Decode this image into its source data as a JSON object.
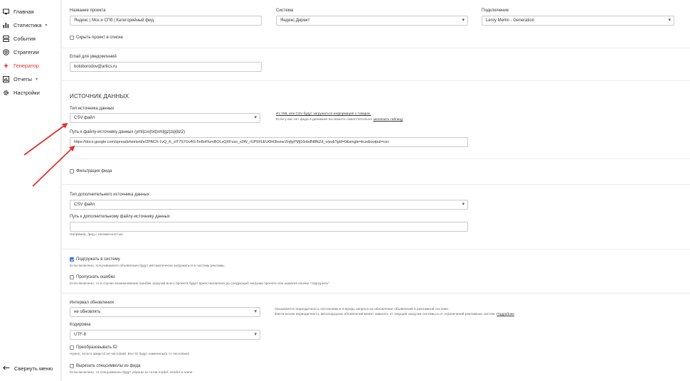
{
  "sidebar": {
    "items": [
      {
        "label": "Главная",
        "icon": "monitor-icon"
      },
      {
        "label": "Статистика",
        "icon": "bar-chart-icon"
      },
      {
        "label": "События",
        "icon": "events-icon"
      },
      {
        "label": "Стратегии",
        "icon": "target-icon"
      },
      {
        "label": "Генератор",
        "icon": "generator-icon"
      },
      {
        "label": "Отчеты",
        "icon": "reports-icon"
      },
      {
        "label": "Настройки",
        "icon": "gear-icon"
      }
    ],
    "collapse_label": "Свернуть меню"
  },
  "form": {
    "project_name_label": "Название проекта",
    "project_name_value": "Яндекс | Мск и СПб | Категорийный фид",
    "system_label": "Система",
    "system_value": "Яндекс.Директ",
    "connection_label": "Подключение",
    "connection_value": "Leroy Merlin - Generation",
    "hide_project_label": "Скрыть проект в списке",
    "email_label": "Email для уведомлений",
    "email_value": "boloborodov@artics.ru",
    "data_source_heading": "ИСТОЧНИК ДАННЫХ",
    "source_type_label": "Тип источника данных",
    "source_type_value": "CSV файл",
    "source_hint_link": "Из YML или CSV будут загружаться информация о товарах.",
    "source_hint_text": "Если у вас нет фида в динамике вы можете самостоятельно",
    "source_hint_fill": "заполнить таблицу",
    "source_path_label": "Путь к файлу-источнику данных (yml|csv|txt|xml|gz|zip|bz2)",
    "source_path_value": "https://docs.google.com/spreadsheets/d/e/2PACX-1vQ_K_sIT7S7GvAS-5n8oFlumBOLsQXFuso_s0W_rUP9XLEUOH3tozw/ZnjfgYMj16nbdN8fkZd_v/pub?gid=0&single=true&output=csv",
    "filter_label": "Фильтрация фида",
    "extra_source_type_label": "Тип дополнительного источника данных",
    "extra_source_type_value": "CSV файл",
    "extra_source_path_label": "Путь к дополнительному файлу-источнику данных",
    "extra_source_path_value": "",
    "extra_source_hint": "Например, фид с неизменностью.",
    "load_label": "Подгружать в систему",
    "load_hint": "Если включено, получившиеся объявления будут автоматически загружаться в систему рекламы.",
    "skip_errors_label": "Пропускать ошибки",
    "skip_errors_hint": "Если включено, то в случае возникновения ошибки загрузки всего проекта будет приостановлена до следующей загрузки проекта или нажатия кнопки \"подгрузить\".",
    "interval_label": "Интервал обновления",
    "interval_value": "не обновлять",
    "interval_hint1": "Указывается периодичность постановки в очередь запроса на обновление объявлений в рекламной системе.",
    "interval_hint2": "Фактическая периодичность автоподгрузок объявлений может зависеть от текущей загрузки системы и от ограничений рекламных систем.",
    "interval_hint_link": "Подробнее",
    "encoding_label": "Кодировка",
    "encoding_value": "UTF-8",
    "convert_id_label": "Преобразовывать ID",
    "convert_id_hint": "Нужно, если в фиде id не числовой. Все ID будут изменены(а то числовые)",
    "cut_special_label": "Вырезать спецсимволы из фида",
    "cut_special_hint": "Если включено, то спецсимволы будут убраны из тегов model, vendor и name"
  },
  "colors": {
    "accent": "#e2322b",
    "checkbox_checked": "#2f6fdb"
  }
}
